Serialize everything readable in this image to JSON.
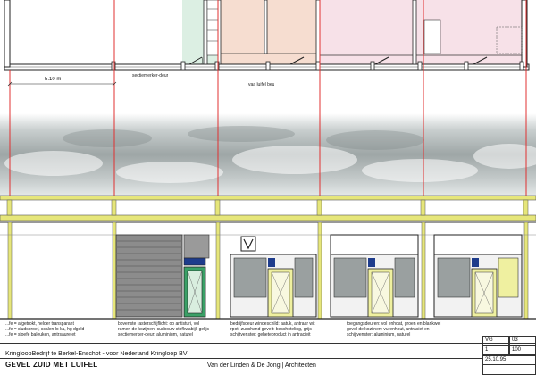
{
  "plan": {
    "dimension_label": "5.10 m",
    "label_left": "sectiemerker-deur",
    "label_mid": "vaa luifel beu"
  },
  "colors": {
    "green_zone": "#dcefe3",
    "peach_zone": "#f6ddd0",
    "pink_zone": "#f7e1e8",
    "grid_red": "#e03030",
    "canopy_yellow": "#e6e67a",
    "door_green": "#3aa066",
    "door_yellow": "#eff0a0",
    "sky_gray": "#a8b0b0",
    "shutter_gray": "#8c8c8c",
    "panel_blue": "#1e3c8c"
  },
  "notes": {
    "col1": [
      "...fe = afgetrokt, helder transparant",
      "...fe = sludsproef, scalen lo ka, hg dgeld",
      "...fe = sloefe baleuken, antrsaure et"
    ],
    "col2": [
      "bovenste rasterschijflicht: oo antisturi, vol",
      "ramen de kozijnen: cusbouw stofkwabijl, gelijs",
      "sectiemerker-deur: aluminium, naturel"
    ],
    "col3": [
      "bedrijfsdeur windeschild: aatuk, antraar wit",
      "rpot- zuuchand gevelt: beschoteling, grijs",
      "schijtvenster: geheteproduct in antracieit"
    ],
    "col4": [
      "toegangsdeuren: vol enhoat, groen en blankwei",
      "gevel de kozijnen: vurenhout, antraciet en",
      "schijtvenster: aluminium, naturel"
    ]
  },
  "title_block": {
    "project": "KringloopBedrijf te Berkel-Enschot - voor Nederland Kringloop BV",
    "drawing_title": "GEVEL ZUID MET LUIFEL",
    "architect": "Van der Linden & De Jong  |  Architecten",
    "code": "VG",
    "sheet_no": "03",
    "sheet_of": "1",
    "scale": "100",
    "date": "25.10.95"
  }
}
